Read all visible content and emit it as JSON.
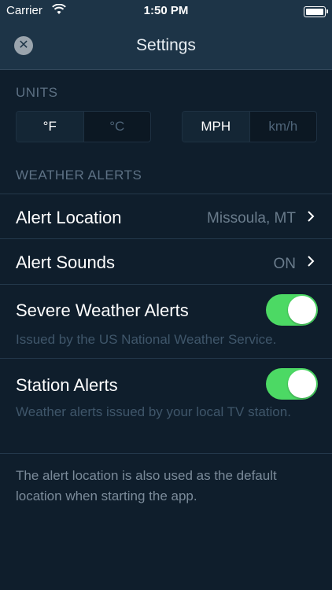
{
  "status_bar": {
    "carrier": "Carrier",
    "time": "1:50 PM"
  },
  "nav": {
    "title": "Settings",
    "close_icon": "close-icon"
  },
  "units": {
    "label": "UNITS",
    "temperature": {
      "options": [
        "°F",
        "°C"
      ],
      "selected": "°F"
    },
    "speed": {
      "options": [
        "MPH",
        "km/h"
      ],
      "selected": "MPH"
    }
  },
  "alerts": {
    "label": "WEATHER ALERTS",
    "location": {
      "label": "Alert Location",
      "value": "Missoula, MT"
    },
    "sounds": {
      "label": "Alert Sounds",
      "value": "ON"
    },
    "severe": {
      "label": "Severe Weather Alerts",
      "description": "Issued by the US National Weather Service.",
      "on": true
    },
    "station": {
      "label": "Station Alerts",
      "description": "Weather alerts issued by your local TV station.",
      "on": true
    }
  },
  "footer": {
    "text": "The alert location is also used as the default location when starting the app."
  },
  "colors": {
    "toggle_on": "#4cd964",
    "background": "#0f1e2c",
    "bar": "#1d3447"
  }
}
